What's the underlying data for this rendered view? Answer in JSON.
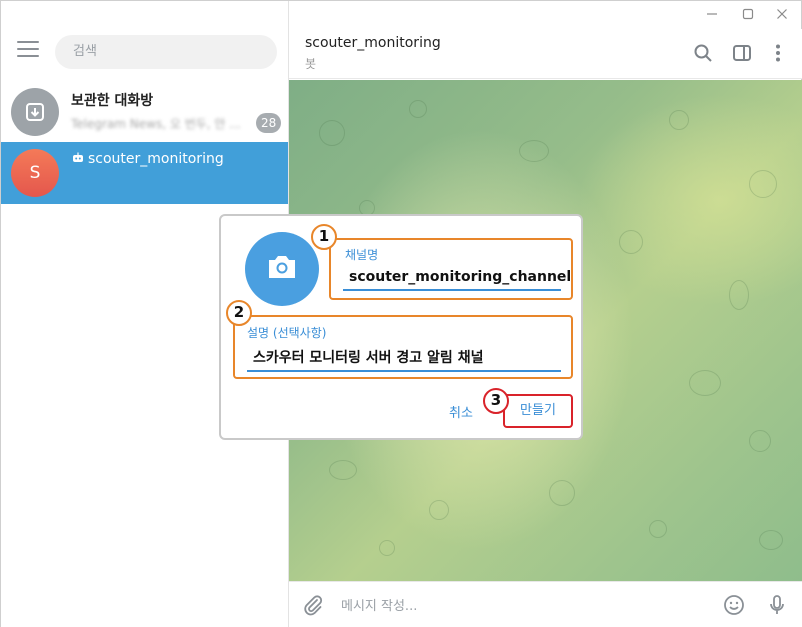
{
  "sidebar": {
    "search_placeholder": "검색",
    "chats": [
      {
        "name": "보관한 대화방",
        "preview": "Telegram News, 오 번두, 안 ...",
        "badge": "28"
      },
      {
        "name": "scouter_monitoring",
        "avatar_letter": "S"
      }
    ]
  },
  "header": {
    "title": "scouter_monitoring",
    "subtitle": "봇"
  },
  "composer": {
    "placeholder": "메시지 작성..."
  },
  "dialog": {
    "channel_name_label": "채널명",
    "channel_name_value": "scouter_monitoring_channel",
    "description_label": "설명 (선택사항)",
    "description_value": "스카우터 모니터링 서버 경고 알림 채널",
    "cancel_label": "취소",
    "create_label": "만들기",
    "steps": [
      "1",
      "2",
      "3"
    ]
  },
  "colors": {
    "accent": "#419fd9",
    "annotation_orange": "#e8862a",
    "annotation_red": "#d9232a",
    "avatar_red": "#e4574d"
  },
  "icons": [
    "minimize-icon",
    "maximize-icon",
    "close-icon",
    "menu-icon",
    "archive-icon",
    "bot-icon",
    "search-icon",
    "sidebar-toggle-icon",
    "more-icon",
    "camera-icon",
    "attach-icon",
    "emoji-icon",
    "microphone-icon"
  ]
}
